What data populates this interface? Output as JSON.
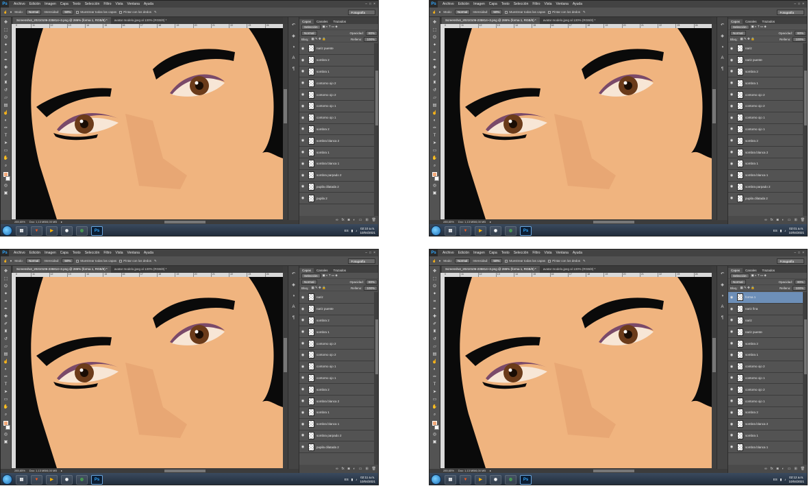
{
  "app": {
    "logo": "Ps",
    "menu": [
      "Archivo",
      "Edición",
      "Imagen",
      "Capa",
      "Texto",
      "Selección",
      "Filtro",
      "Vista",
      "Ventana",
      "Ayuda"
    ],
    "options": {
      "mode_label": "Modo:",
      "mode_value": "Normal",
      "intensity_label": "Intensidad:",
      "intensity_value": "50%",
      "sample_all": "Muestrear todas las capas",
      "finger_paint": "Pintar con los dedos",
      "workspace": "Fotografía"
    },
    "tabs": [
      "Screenshot_20210106-235814~3.png @ 286% (forma 1, RGB/8) *",
      "avatar modelo.jpeg al 130% (RGB/8) *"
    ],
    "ruler_ticks": [
      "10",
      "11",
      "12",
      "13",
      "14",
      "15",
      "16",
      "17",
      "18",
      "19",
      "20",
      "21",
      "22",
      "23",
      "24"
    ],
    "status": {
      "zoom": "285,65%",
      "doc": "Doc: 1,13 MB/6,00 MB"
    },
    "panel": {
      "tabs": [
        "Capas",
        "Canales",
        "Trazados"
      ],
      "kind_filter": "Selección",
      "blend_mode": "Normal",
      "opacity_label": "Opacidad:",
      "opacity_value": "80%",
      "lock_label": "Bloq.:",
      "fill_label": "Relleno:",
      "fill_value": "100%"
    },
    "taskbar": {
      "lang": "ES"
    }
  },
  "screens": [
    {
      "time": "02:10 a.m.",
      "date": "10/04/2021",
      "layers": [
        "nariz puente",
        "sombra 2",
        "sombra 1",
        "contorno ojo 2",
        "contorno ojo 2",
        "contorno ojo 1",
        "contorno ojo 1",
        "sombra 2",
        "sombra blanca 2",
        "sombra 1",
        "sombra blanca 1",
        "sombra parpado 2",
        "pupila dilatada 2",
        "pupila 2"
      ],
      "selected": -1
    },
    {
      "time": "02:01 a.m.",
      "date": "10/04/2021",
      "layers": [
        "nariz",
        "nariz puente",
        "sombra 2",
        "sombra 1",
        "contorno ojo 2",
        "contorno ojo 2",
        "contorno ojo 1",
        "contorno ojo 1",
        "sombra 2",
        "sombra blanca 2",
        "sombra 1",
        "sombra blanca 1",
        "sombra parpado 2",
        "pupila dilatada 2"
      ],
      "selected": -1
    },
    {
      "time": "02:11 a.m.",
      "date": "10/04/2021",
      "layers": [
        "nariz",
        "nariz puente",
        "sombra 2",
        "sombra 1",
        "contorno ojo 2",
        "contorno ojo 2",
        "contorno ojo 1",
        "contorno ojo 1",
        "sombra 2",
        "sombra blanca 2",
        "sombra 1",
        "sombra blanca 1",
        "sombra parpado 2",
        "pupila dilatada 2"
      ],
      "selected": -1
    },
    {
      "time": "02:12 a.m.",
      "date": "10/04/2021",
      "layers": [
        "forma 1",
        "nariz fina",
        "nariz",
        "nariz puente",
        "sombra 2",
        "sombra 1",
        "contorno ojo 2",
        "contorno ojo 1",
        "contorno ojo 2",
        "contorno ojo 1",
        "sombra 2",
        "sombra blanca 2",
        "sombra 1",
        "sombra blanca 1"
      ],
      "selected": 0
    }
  ],
  "colors": {
    "skin": "#f0b47f",
    "nose_shadow": "#e8a774",
    "hair": "#0a0a0a",
    "iris": "#6b3b1a",
    "eyeshadow": "#7a4a6a",
    "selection": "#6d8fb8",
    "ps_blue": "#31a8ff"
  },
  "icons": {
    "eye": "eye-icon",
    "start": "windows-start-icon",
    "brave": "brave-icon",
    "chrome": "chrome-icon",
    "folder": "folder-icon",
    "photoshop": "photoshop-icon"
  }
}
